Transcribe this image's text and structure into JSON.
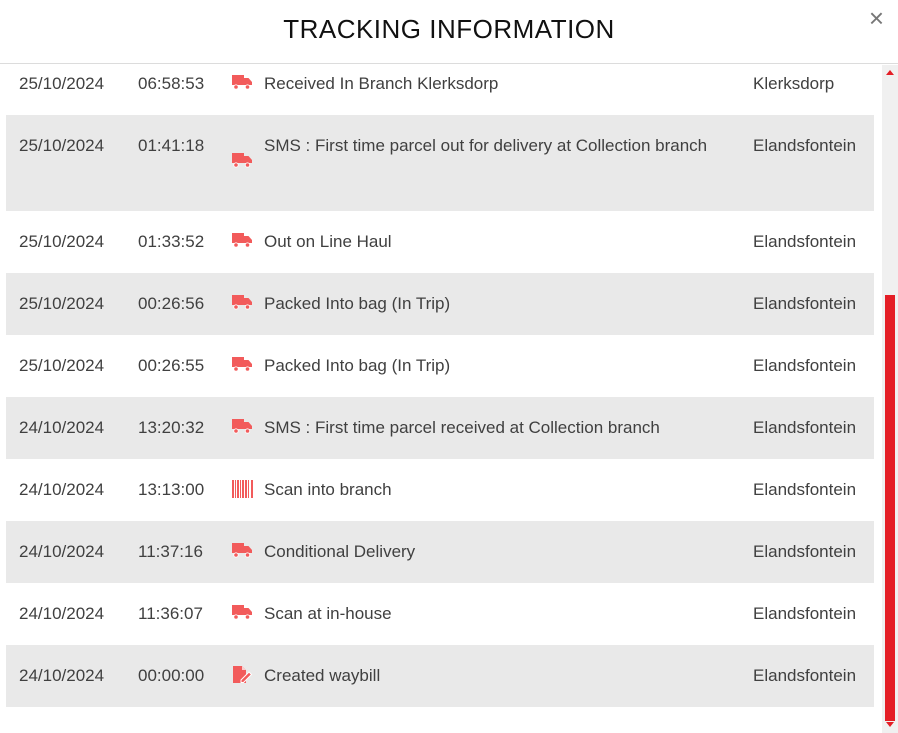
{
  "modal": {
    "title": "TRACKING INFORMATION",
    "close_symbol": "×"
  },
  "accent_color": "#f25b5b",
  "scrollbar_color": "#e41e26",
  "rows": [
    {
      "date": "25/10/2024",
      "time": "06:58:53",
      "icon": "truck-icon",
      "description": "Received In Branch Klerksdorp",
      "location": "Klerksdorp"
    },
    {
      "date": "25/10/2024",
      "time": "01:41:18",
      "icon": "truck-icon",
      "description": "SMS : First time parcel out for delivery at Collection branch",
      "location": "Elandsfontein"
    },
    {
      "date": "25/10/2024",
      "time": "01:33:52",
      "icon": "truck-icon",
      "description": "Out on Line Haul",
      "location": "Elandsfontein"
    },
    {
      "date": "25/10/2024",
      "time": "00:26:56",
      "icon": "truck-icon",
      "description": "Packed Into bag (In Trip)",
      "location": "Elandsfontein"
    },
    {
      "date": "25/10/2024",
      "time": "00:26:55",
      "icon": "truck-icon",
      "description": "Packed Into bag (In Trip)",
      "location": "Elandsfontein"
    },
    {
      "date": "24/10/2024",
      "time": "13:20:32",
      "icon": "truck-icon",
      "description": "SMS : First time parcel received at Collection branch",
      "location": "Elandsfontein"
    },
    {
      "date": "24/10/2024",
      "time": "13:13:00",
      "icon": "barcode-icon",
      "description": "Scan into branch",
      "location": "Elandsfontein"
    },
    {
      "date": "24/10/2024",
      "time": "11:37:16",
      "icon": "truck-icon",
      "description": "Conditional Delivery",
      "location": "Elandsfontein"
    },
    {
      "date": "24/10/2024",
      "time": "11:36:07",
      "icon": "truck-icon",
      "description": "Scan at in-house",
      "location": "Elandsfontein"
    },
    {
      "date": "24/10/2024",
      "time": "00:00:00",
      "icon": "document-edit-icon",
      "description": "Created waybill",
      "location": "Elandsfontein"
    }
  ]
}
